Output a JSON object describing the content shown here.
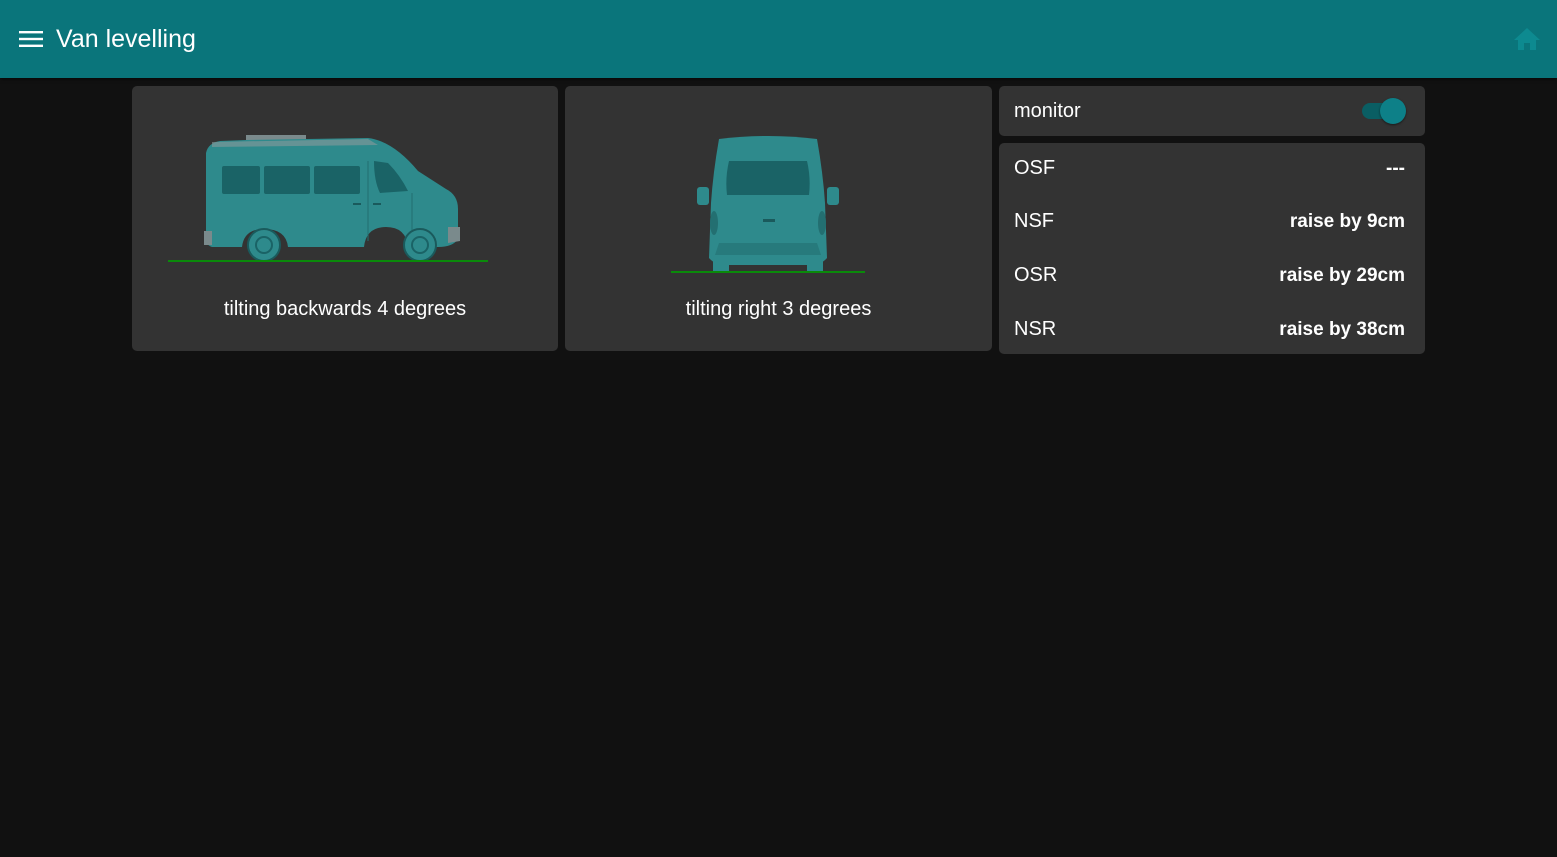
{
  "header": {
    "title": "Van levelling",
    "menu_icon": "hamburger-menu-icon",
    "home_icon": "home-icon"
  },
  "side_view": {
    "caption": "tilting backwards 4 degrees"
  },
  "rear_view": {
    "caption": "tilting right 3 degrees"
  },
  "monitor": {
    "label": "monitor",
    "enabled": true
  },
  "legs": [
    {
      "name": "OSF",
      "value": "---"
    },
    {
      "name": "NSF",
      "value": "raise by 9cm"
    },
    {
      "name": "OSR",
      "value": "raise by 29cm"
    },
    {
      "name": "NSR",
      "value": "raise by 38cm"
    }
  ],
  "colors": {
    "header": "#0a757b",
    "accent": "#0d8088",
    "van_body": "#2e8a8c",
    "ground_line": "#0a8a0a",
    "card": "#333333",
    "background": "#111111"
  }
}
